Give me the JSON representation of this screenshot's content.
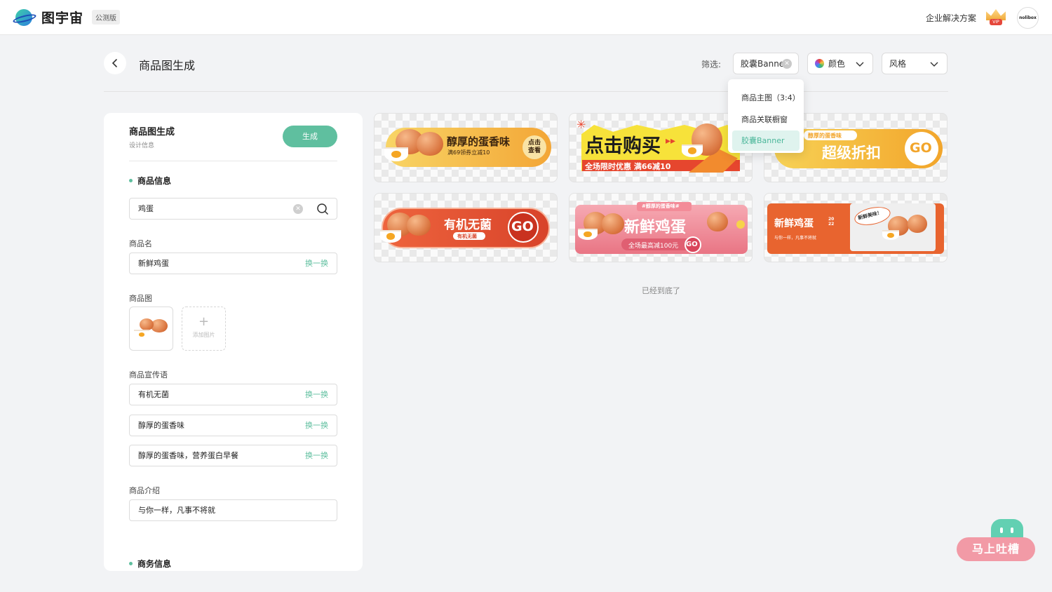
{
  "topbar": {
    "logo_text": "图宇宙",
    "beta_label": "公测版",
    "enterprise_link": "企业解决方案",
    "vip_label": "VIP",
    "avatar_text": "nolibox"
  },
  "header": {
    "title": "商品图生成",
    "filter_label": "筛选:",
    "filter_type_value": "胶囊Banner",
    "filter_color_label": "颜色",
    "filter_style_label": "风格"
  },
  "dropdown": {
    "items": [
      "商品主图（3:4）",
      "商品关联橱窗",
      "胶囊Banner"
    ],
    "selected": "胶囊Banner"
  },
  "panel": {
    "title": "商品图生成",
    "subtitle": "设计信息",
    "generate_label": "生成",
    "section_product": "商品信息",
    "search_value": "鸡蛋",
    "name_label": "商品名",
    "name_value": "新鲜鸡蛋",
    "swap_label": "换一换",
    "image_label": "商品图",
    "add_image_label": "添加图片",
    "slogan_label": "商品宣传语",
    "slogans": [
      "有机无菌",
      "醇厚的蛋香味",
      "醇厚的蛋香味，营养蛋白早餐"
    ],
    "intro_label": "商品介绍",
    "intro_value": "与你一样，凡事不将就",
    "section_business": "商务信息"
  },
  "banners": [
    {
      "title": "醇厚的蛋香味",
      "sub": "满69领券立减10",
      "cta": "点击查看",
      "colors": [
        "#f6c34a",
        "#f29b2f"
      ]
    },
    {
      "title": "点击购买",
      "sub": "全场限时优惠 满66减10",
      "colors": [
        "#f7e23a",
        "#e6462e"
      ]
    },
    {
      "title": "超级折扣",
      "tag": "醇厚的蛋香味",
      "cta": "GO",
      "colors": [
        "#f7c842",
        "#f3a42c"
      ]
    },
    {
      "title": "有机无菌",
      "tag": "有机无菌",
      "cta": "GO",
      "colors": [
        "#ec5d39",
        "#d8432a"
      ]
    },
    {
      "title": "新鲜鸡蛋",
      "tag": "#醇厚的蛋香味#",
      "sub": "全场最高减100元",
      "cta": "GO",
      "colors": [
        "#f49aa6",
        "#e97584"
      ]
    },
    {
      "title": "新鲜鸡蛋",
      "year_top": "20",
      "year_bottom": "22",
      "sub": "与你一样，凡事不将就",
      "badge": "新鲜美味！",
      "colors": [
        "#e8642f",
        "#f2f2f2"
      ]
    }
  ],
  "end_text": "已经到底了",
  "feedback": {
    "label": "马上吐槽"
  }
}
